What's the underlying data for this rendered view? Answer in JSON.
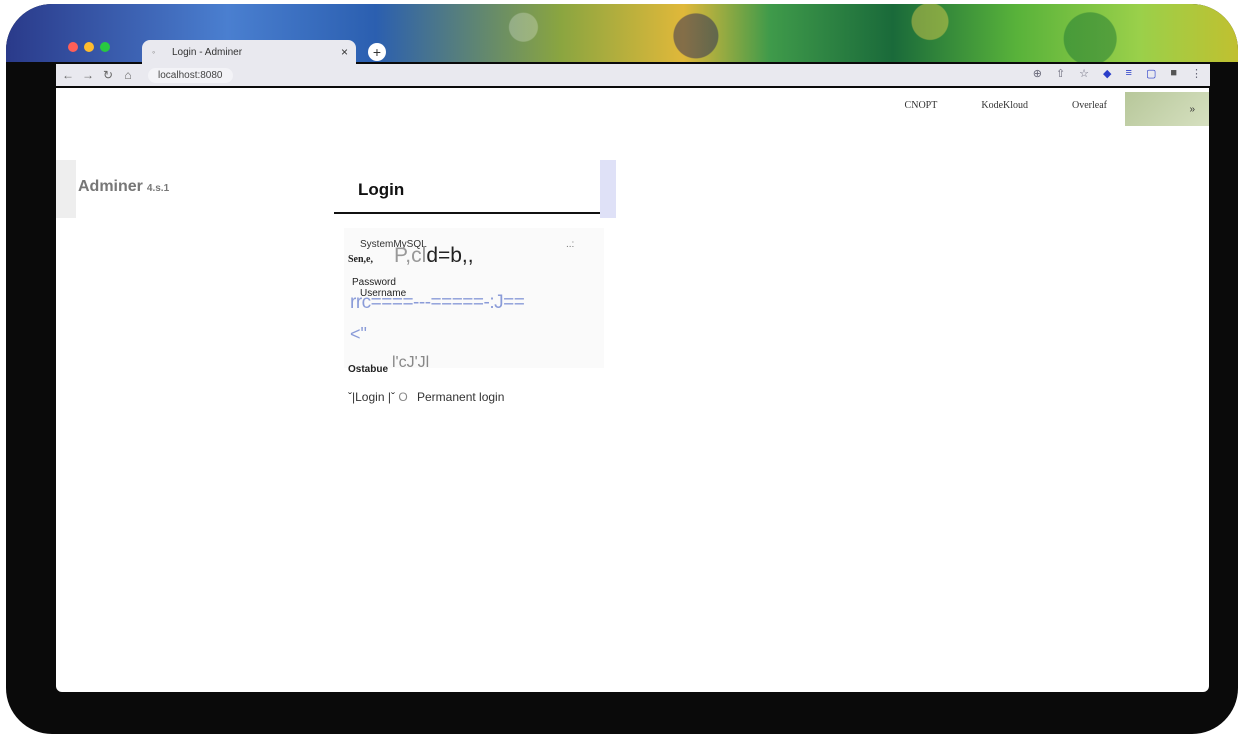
{
  "browser": {
    "tab_title": "Login - Adminer",
    "tab_close": "×",
    "new_tab": "+",
    "url": "localhost:8080",
    "nav": {
      "back": "←",
      "forward": "→",
      "reload": "↻",
      "home": "⌂"
    },
    "traffic_colors": [
      "#ff5f57",
      "#febc2e",
      "#28c840"
    ],
    "toolbar_icons": [
      "zoom-icon",
      "share-icon",
      "star-icon",
      "extension-icon",
      "reading-list-icon",
      "sidebar-icon",
      "profile-icon",
      "kebab-icon"
    ]
  },
  "bookmarks": {
    "items": [
      "CNOPT",
      "KodeKloud",
      "Overleaf"
    ],
    "overflow": "»"
  },
  "app": {
    "name": "Adminer",
    "version": "4.s.1"
  },
  "login": {
    "heading": "Login",
    "system_label": "SystemMySQL",
    "system_caret": "..:",
    "server_label": "Sen,e,",
    "server_value_light": "P,cl",
    "server_value_dark": "d=b,,",
    "password_label": "Password",
    "username_label": "Username",
    "password_value": "rrc====---=====-:J==",
    "username_value": "<\"",
    "database_label": "Ostabue",
    "database_value": "l'cJ'Jl",
    "login_button": "Login",
    "login_marker_left": "ˇ|",
    "login_marker_right": "|ˇ",
    "permanent_radio": "O",
    "permanent_label": "Permanent login"
  }
}
